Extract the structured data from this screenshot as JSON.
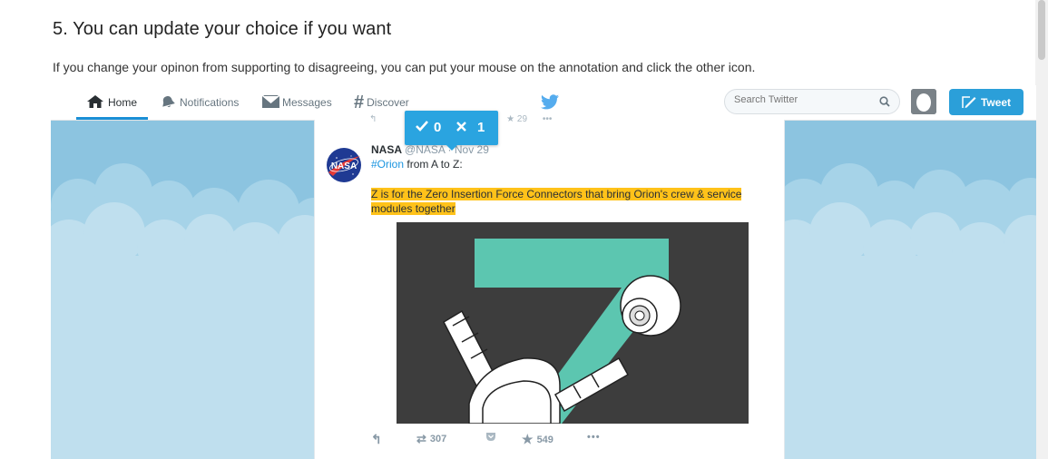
{
  "instructions": {
    "title": "5. You can update your choice if you want",
    "description": "If you change your opinon from supporting to disagreeing, you can put your mouse on the annotation and click the other icon."
  },
  "twitter": {
    "nav": {
      "home": "Home",
      "notifications": "Notifications",
      "messages": "Messages",
      "discover": "Discover"
    },
    "search": {
      "placeholder": "Search Twitter"
    },
    "tweet_button": "Tweet"
  },
  "tweet": {
    "author_name": "NASA",
    "author_handle": "@NASA · Nov 29",
    "hashtag": "#Orion",
    "text_rest": " from A to Z:",
    "highlighted_text": "Z is for the Zero Insertion Force Connectors that bring Orion's crew & service modules together",
    "retweets": "307",
    "favorites": "549",
    "prev_tweet_count": "29"
  },
  "annotation": {
    "support_count": "0",
    "disagree_count": "1"
  },
  "colors": {
    "twitter_blue": "#2b9fd9",
    "highlight": "#ffc21a",
    "sky": "#bfdfee",
    "letter_z": "#5cc6b0"
  }
}
